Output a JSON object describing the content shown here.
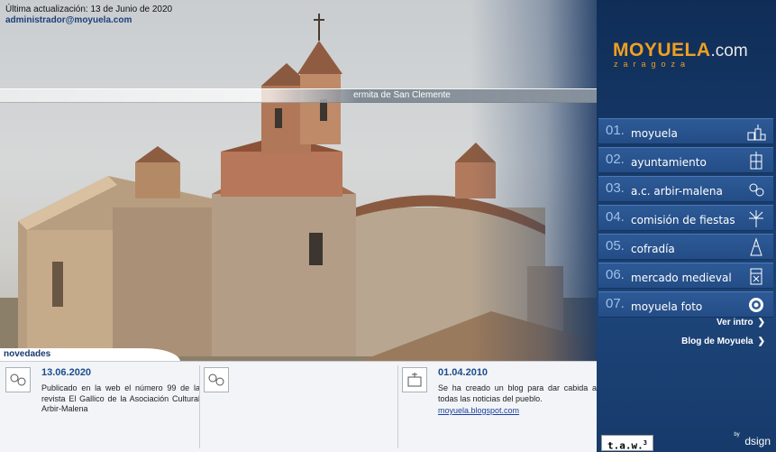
{
  "header": {
    "update_text": "Última actualización: 13 de Junio de 2020",
    "email": "administrador@moyuela.com"
  },
  "photo": {
    "caption": "ermita de San Clemente"
  },
  "logo": {
    "name": "MOYUELA",
    "tld": ".com",
    "region": "zaragoza"
  },
  "menu": [
    {
      "num": "01.",
      "label": "moyuela",
      "icon": "village-icon"
    },
    {
      "num": "02.",
      "label": "ayuntamiento",
      "icon": "townhall-icon"
    },
    {
      "num": "03.",
      "label": "a.c. arbir-malena",
      "icon": "association-icon"
    },
    {
      "num": "04.",
      "label": "comisión de fiestas",
      "icon": "fireworks-icon"
    },
    {
      "num": "05.",
      "label": "cofradía",
      "icon": "hood-icon"
    },
    {
      "num": "06.",
      "label": "mercado medieval",
      "icon": "banner-icon"
    },
    {
      "num": "07.",
      "label": "moyuela foto",
      "icon": "camera-lens-icon"
    }
  ],
  "links": {
    "intro": "Ver intro",
    "blog": "Blog de Moyuela"
  },
  "news": {
    "title": "novedades",
    "items": [
      {
        "date": "13.06.2020",
        "text": "Publicado en la web el número 99 de la revista El Gallico de la Asociación Cultural Arbir-Malena",
        "link": ""
      },
      {
        "date": "",
        "text": "",
        "link": ""
      },
      {
        "date": "01.04.2010",
        "text": "Se ha creado un blog para dar cabida a todas las noticias del pueblo.",
        "link": "moyuela.blogspot.com"
      }
    ]
  },
  "footer": {
    "taw": "t.a.w.",
    "taw_sup": "3",
    "by": "by",
    "design": "dsign"
  },
  "colors": {
    "sidebar": "#173a6a",
    "accent": "#f0a020",
    "menu_item": "#2d5a97",
    "news_bg": "#f2f4f7",
    "link": "#1c3f78"
  }
}
